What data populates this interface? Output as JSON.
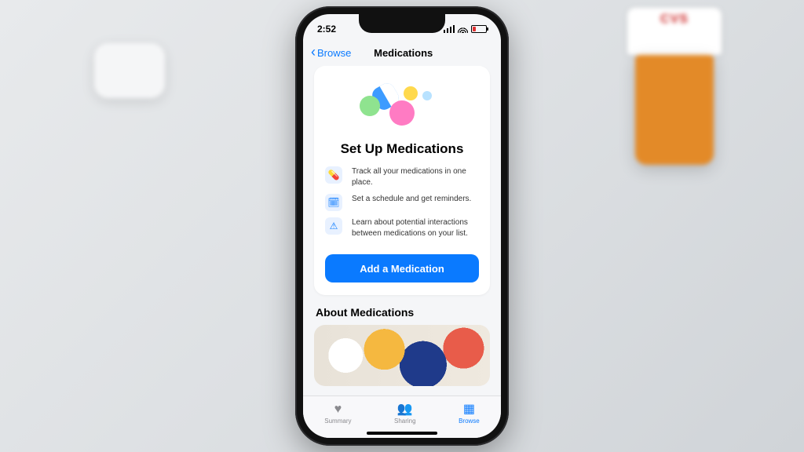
{
  "status_bar": {
    "time": "2:52"
  },
  "nav": {
    "back_label": "Browse",
    "title": "Medications"
  },
  "setup": {
    "heading": "Set Up Medications",
    "benefits": [
      {
        "icon": "pills",
        "text": "Track all your medications in one place."
      },
      {
        "icon": "calendar",
        "text": "Set a schedule and get reminders."
      },
      {
        "icon": "warning",
        "text": "Learn about potential interactions between medications on your list."
      }
    ],
    "cta_label": "Add a Medication"
  },
  "about": {
    "heading": "About Medications"
  },
  "tabs": [
    {
      "id": "summary",
      "label": "Summary",
      "active": false
    },
    {
      "id": "sharing",
      "label": "Sharing",
      "active": false
    },
    {
      "id": "browse",
      "label": "Browse",
      "active": true
    }
  ],
  "background_props": {
    "bottle_brand": "CVS"
  }
}
